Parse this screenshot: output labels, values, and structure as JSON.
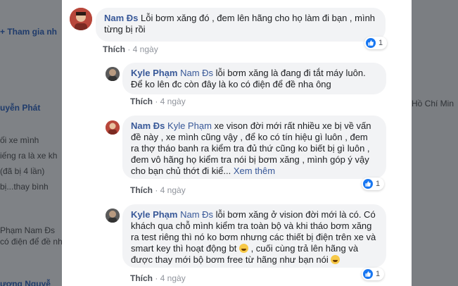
{
  "background": {
    "left_lines": [
      "+ Tham gia nh",
      "uyễn Phát",
      "ối xe mình",
      "iếng ra là xe kh",
      "(đã bị 4 lần)",
      "bị...thay bình",
      "Phạm Nam Đs",
      "có điện để đề nhé",
      "ương Nguyễ"
    ],
    "right_lines": [
      "Hồ Chí Min"
    ]
  },
  "comments": [
    {
      "author": "Nam Đs",
      "mention": "",
      "text": " Lỗi bơm xăng đó , đem lên hãng cho họ làm đi bạn , mình từng bị rồi",
      "more": "",
      "like_label": "Thích",
      "time": "4 ngày",
      "reaction_count": "1"
    },
    {
      "author": "Kyle Phạm",
      "mention": " Nam Đs",
      "text": " lỗi bơm xăng là đang đi tắt máy luôn. Để ko lên đc còn đây là ko có điện để đề nha ông",
      "more": "",
      "like_label": "Thích",
      "time": "4 ngày",
      "reaction_count": ""
    },
    {
      "author": "Nam Đs",
      "mention": " Kyle Phạm",
      "text": " xe vison đời mới rất nhiều xe bị về vấn đề này , xe mình cũng vậy , để ko có tín hiệu gì luôn , đem ra thợ tháo banh ra kiểm tra đủ thứ cũng ko biết bị gì luôn , đem vô hãng họ kiểm tra nói bị bơm xăng , mình góp ý vậy cho bạn chủ thớt đi kiể...",
      "more": " Xem thêm",
      "like_label": "Thích",
      "time": "4 ngày",
      "reaction_count": "1"
    },
    {
      "author": "Kyle Phạm",
      "mention": " Nam Đs",
      "text_a": " lỗi bơm xăng ở vision đời mới là có. Có khách qua chỗ mình kiểm tra toàn bộ và khi tháo bơm xăng ra test riêng thì nó ko bơm nhưng các thiết bị điện trên xe và smart key thì hoạt động bt",
      "text_b": ", cuối cùng trả lên hãng và được thay mới bộ bơm free từ hãng như bạn nói",
      "emoji_names": [
        "laughing-emoji",
        "smiling-emoji"
      ],
      "like_label": "Thích",
      "time": "4 ngày",
      "reaction_count": "1"
    }
  ],
  "colors": {
    "link": "#385898",
    "bubble": "#f2f3f5",
    "like_blue": "#1877f2"
  }
}
